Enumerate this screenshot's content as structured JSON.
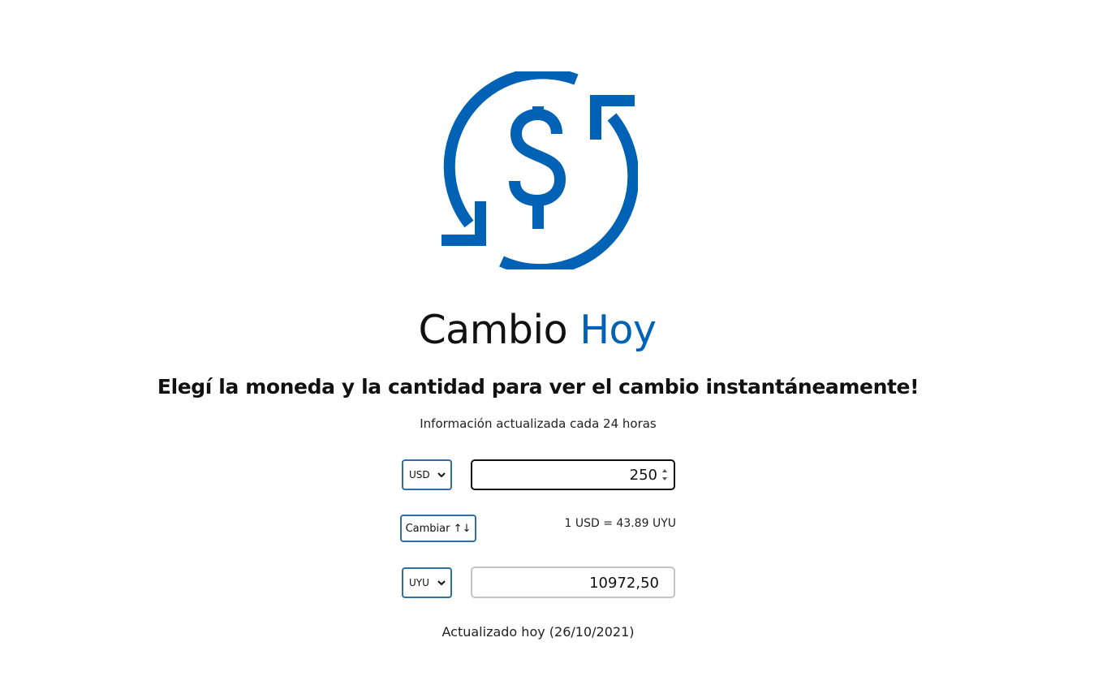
{
  "header": {
    "title_main": "Cambio",
    "title_accent": "Hoy",
    "subtitle": "Elegí la moneda y la cantidad para ver el cambio instantáneamente!",
    "info": "Información actualizada cada 24 horas"
  },
  "logo": {
    "icon": "currency-exchange-icon",
    "color": "#0062b5"
  },
  "converter": {
    "from_currency": "USD",
    "amount": "250",
    "swap_label": "Cambiar ↑↓",
    "rate_text": "1 USD = 43.89 UYU",
    "to_currency": "UYU",
    "result": "10972,50"
  },
  "footer": {
    "updated": "Actualizado hoy (26/10/2021)"
  },
  "colors": {
    "accent": "#0062b5",
    "control_border": "#2f6fa6"
  }
}
